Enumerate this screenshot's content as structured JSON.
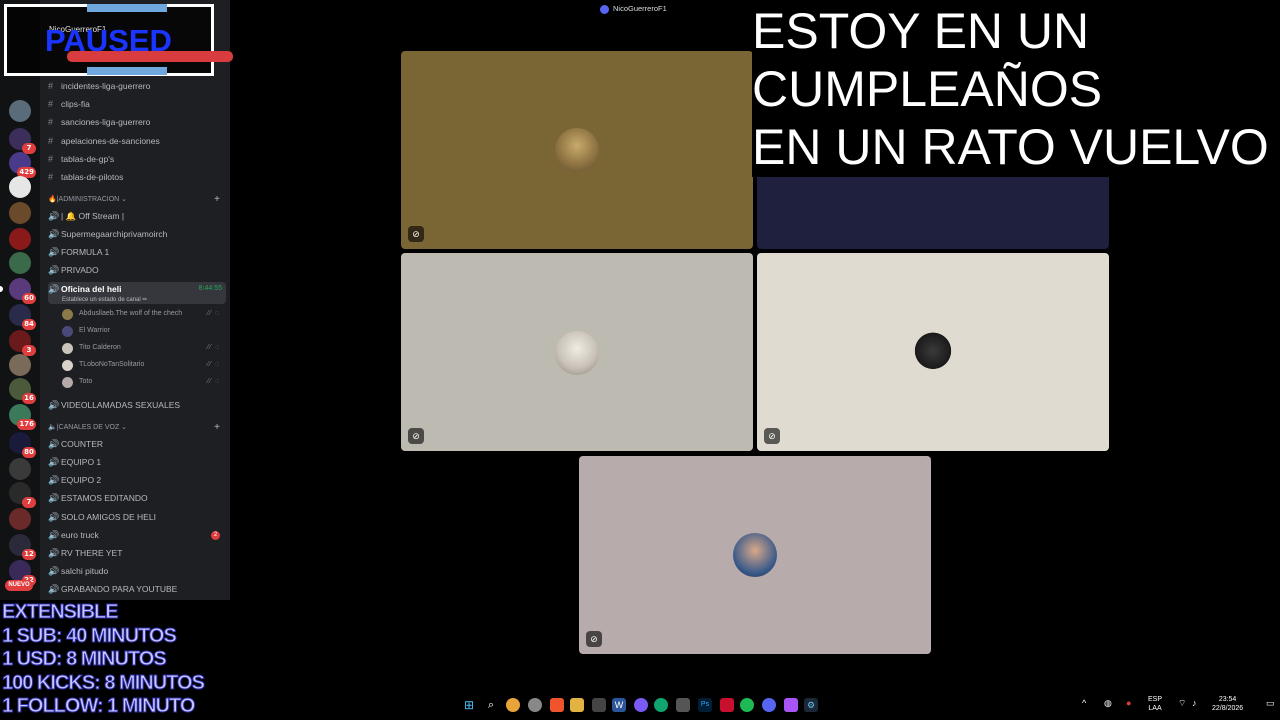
{
  "window": {
    "title": "NicoGuerreroF1"
  },
  "paused_overlay": {
    "label": "PAUSED",
    "server_name": "NicoGuerreroF1"
  },
  "stream_overlay": {
    "lines": [
      "ESTOY EN UN",
      "CUMPLEAÑOS",
      "EN UN RATO VUELVO"
    ]
  },
  "promo": {
    "lines": [
      "EXTENSIBLE",
      "1 SUB: 40 MINUTOS",
      "1 USD: 8 MINUTOS",
      "100 KICKS: 8 MINUTOS",
      "1 FOLLOW: 1 MINUTO"
    ]
  },
  "server_rail": {
    "badges": [
      "7",
      "429",
      "60",
      "84",
      "3",
      "16",
      "176",
      "80",
      "7",
      "12",
      "22",
      "NUEVO"
    ]
  },
  "sidebar": {
    "text_channels": [
      "incidentes-liga-guerrero",
      "clips-fia",
      "sanciones-liga-guerrero",
      "apelaciones-de-sanciones",
      "tablas-de-gp's",
      "tablas-de-pilotos"
    ],
    "category_admin": "ADMINISTRACION",
    "admin_channels": [
      "| 🔔 Off Stream |",
      "Supermegaarchiprivamoirch",
      "FORMULA 1",
      "PRIVADO"
    ],
    "active_channel": {
      "name": "Oficina del heli",
      "timer": "8:44:55",
      "status": "Establece un estado de canal ✏"
    },
    "voice_users": [
      "Abdusllaeb.The wolf of the chech",
      "El Warrior",
      "Tito Calderon",
      "TLoboNoTanSolitario",
      "Toto"
    ],
    "after_users_channel": "VIDEOLLAMADAS SEXUALES",
    "category_voice": "CANALES DE VOZ",
    "voice_channels": [
      "COUNTER",
      "EQUIPO 1",
      "EQUIPO 2",
      "ESTAMOS EDITANDO",
      "SOLO AMIGOS DE HELI",
      "euro truck",
      "RV THERE YET",
      "salchi pitudo",
      "GRABANDO PARA YOUTUBE"
    ],
    "euro_truck_count": "2"
  },
  "taskbar": {
    "lang_top": "ESP",
    "lang_bottom": "LAA",
    "time": "23:54",
    "date": "22/8/2026"
  },
  "colors": {
    "tile1": "#7a6535",
    "tile2": "#1f1f3e",
    "tile3": "#bdbab2",
    "tile4": "#e0dbd1",
    "tile5": "#b7acab",
    "accent": "#5865f2",
    "voice_active": "#23a55a"
  }
}
